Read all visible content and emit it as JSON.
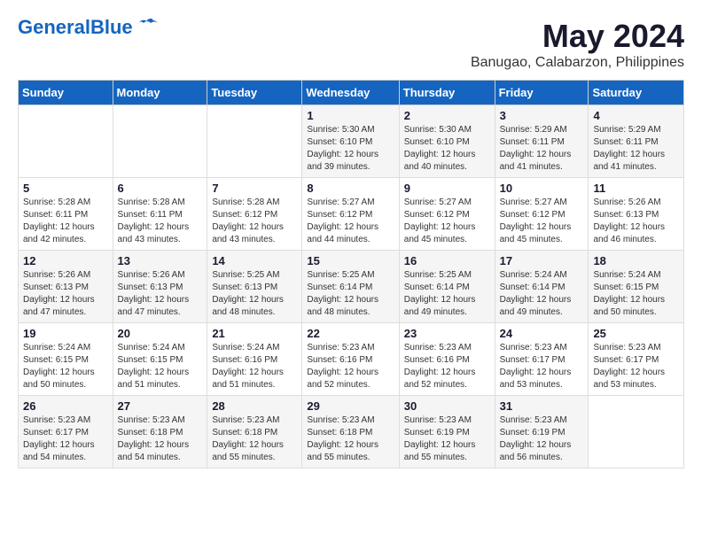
{
  "logo": {
    "general": "General",
    "blue": "Blue"
  },
  "header": {
    "month": "May 2024",
    "location": "Banugao, Calabarzon, Philippines"
  },
  "weekdays": [
    "Sunday",
    "Monday",
    "Tuesday",
    "Wednesday",
    "Thursday",
    "Friday",
    "Saturday"
  ],
  "weeks": [
    [
      {
        "day": "",
        "sunrise": "",
        "sunset": "",
        "daylight": ""
      },
      {
        "day": "",
        "sunrise": "",
        "sunset": "",
        "daylight": ""
      },
      {
        "day": "",
        "sunrise": "",
        "sunset": "",
        "daylight": ""
      },
      {
        "day": "1",
        "sunrise": "Sunrise: 5:30 AM",
        "sunset": "Sunset: 6:10 PM",
        "daylight": "Daylight: 12 hours and 39 minutes."
      },
      {
        "day": "2",
        "sunrise": "Sunrise: 5:30 AM",
        "sunset": "Sunset: 6:10 PM",
        "daylight": "Daylight: 12 hours and 40 minutes."
      },
      {
        "day": "3",
        "sunrise": "Sunrise: 5:29 AM",
        "sunset": "Sunset: 6:11 PM",
        "daylight": "Daylight: 12 hours and 41 minutes."
      },
      {
        "day": "4",
        "sunrise": "Sunrise: 5:29 AM",
        "sunset": "Sunset: 6:11 PM",
        "daylight": "Daylight: 12 hours and 41 minutes."
      }
    ],
    [
      {
        "day": "5",
        "sunrise": "Sunrise: 5:28 AM",
        "sunset": "Sunset: 6:11 PM",
        "daylight": "Daylight: 12 hours and 42 minutes."
      },
      {
        "day": "6",
        "sunrise": "Sunrise: 5:28 AM",
        "sunset": "Sunset: 6:11 PM",
        "daylight": "Daylight: 12 hours and 43 minutes."
      },
      {
        "day": "7",
        "sunrise": "Sunrise: 5:28 AM",
        "sunset": "Sunset: 6:12 PM",
        "daylight": "Daylight: 12 hours and 43 minutes."
      },
      {
        "day": "8",
        "sunrise": "Sunrise: 5:27 AM",
        "sunset": "Sunset: 6:12 PM",
        "daylight": "Daylight: 12 hours and 44 minutes."
      },
      {
        "day": "9",
        "sunrise": "Sunrise: 5:27 AM",
        "sunset": "Sunset: 6:12 PM",
        "daylight": "Daylight: 12 hours and 45 minutes."
      },
      {
        "day": "10",
        "sunrise": "Sunrise: 5:27 AM",
        "sunset": "Sunset: 6:12 PM",
        "daylight": "Daylight: 12 hours and 45 minutes."
      },
      {
        "day": "11",
        "sunrise": "Sunrise: 5:26 AM",
        "sunset": "Sunset: 6:13 PM",
        "daylight": "Daylight: 12 hours and 46 minutes."
      }
    ],
    [
      {
        "day": "12",
        "sunrise": "Sunrise: 5:26 AM",
        "sunset": "Sunset: 6:13 PM",
        "daylight": "Daylight: 12 hours and 47 minutes."
      },
      {
        "day": "13",
        "sunrise": "Sunrise: 5:26 AM",
        "sunset": "Sunset: 6:13 PM",
        "daylight": "Daylight: 12 hours and 47 minutes."
      },
      {
        "day": "14",
        "sunrise": "Sunrise: 5:25 AM",
        "sunset": "Sunset: 6:13 PM",
        "daylight": "Daylight: 12 hours and 48 minutes."
      },
      {
        "day": "15",
        "sunrise": "Sunrise: 5:25 AM",
        "sunset": "Sunset: 6:14 PM",
        "daylight": "Daylight: 12 hours and 48 minutes."
      },
      {
        "day": "16",
        "sunrise": "Sunrise: 5:25 AM",
        "sunset": "Sunset: 6:14 PM",
        "daylight": "Daylight: 12 hours and 49 minutes."
      },
      {
        "day": "17",
        "sunrise": "Sunrise: 5:24 AM",
        "sunset": "Sunset: 6:14 PM",
        "daylight": "Daylight: 12 hours and 49 minutes."
      },
      {
        "day": "18",
        "sunrise": "Sunrise: 5:24 AM",
        "sunset": "Sunset: 6:15 PM",
        "daylight": "Daylight: 12 hours and 50 minutes."
      }
    ],
    [
      {
        "day": "19",
        "sunrise": "Sunrise: 5:24 AM",
        "sunset": "Sunset: 6:15 PM",
        "daylight": "Daylight: 12 hours and 50 minutes."
      },
      {
        "day": "20",
        "sunrise": "Sunrise: 5:24 AM",
        "sunset": "Sunset: 6:15 PM",
        "daylight": "Daylight: 12 hours and 51 minutes."
      },
      {
        "day": "21",
        "sunrise": "Sunrise: 5:24 AM",
        "sunset": "Sunset: 6:16 PM",
        "daylight": "Daylight: 12 hours and 51 minutes."
      },
      {
        "day": "22",
        "sunrise": "Sunrise: 5:23 AM",
        "sunset": "Sunset: 6:16 PM",
        "daylight": "Daylight: 12 hours and 52 minutes."
      },
      {
        "day": "23",
        "sunrise": "Sunrise: 5:23 AM",
        "sunset": "Sunset: 6:16 PM",
        "daylight": "Daylight: 12 hours and 52 minutes."
      },
      {
        "day": "24",
        "sunrise": "Sunrise: 5:23 AM",
        "sunset": "Sunset: 6:17 PM",
        "daylight": "Daylight: 12 hours and 53 minutes."
      },
      {
        "day": "25",
        "sunrise": "Sunrise: 5:23 AM",
        "sunset": "Sunset: 6:17 PM",
        "daylight": "Daylight: 12 hours and 53 minutes."
      }
    ],
    [
      {
        "day": "26",
        "sunrise": "Sunrise: 5:23 AM",
        "sunset": "Sunset: 6:17 PM",
        "daylight": "Daylight: 12 hours and 54 minutes."
      },
      {
        "day": "27",
        "sunrise": "Sunrise: 5:23 AM",
        "sunset": "Sunset: 6:18 PM",
        "daylight": "Daylight: 12 hours and 54 minutes."
      },
      {
        "day": "28",
        "sunrise": "Sunrise: 5:23 AM",
        "sunset": "Sunset: 6:18 PM",
        "daylight": "Daylight: 12 hours and 55 minutes."
      },
      {
        "day": "29",
        "sunrise": "Sunrise: 5:23 AM",
        "sunset": "Sunset: 6:18 PM",
        "daylight": "Daylight: 12 hours and 55 minutes."
      },
      {
        "day": "30",
        "sunrise": "Sunrise: 5:23 AM",
        "sunset": "Sunset: 6:19 PM",
        "daylight": "Daylight: 12 hours and 55 minutes."
      },
      {
        "day": "31",
        "sunrise": "Sunrise: 5:23 AM",
        "sunset": "Sunset: 6:19 PM",
        "daylight": "Daylight: 12 hours and 56 minutes."
      },
      {
        "day": "",
        "sunrise": "",
        "sunset": "",
        "daylight": ""
      }
    ]
  ]
}
